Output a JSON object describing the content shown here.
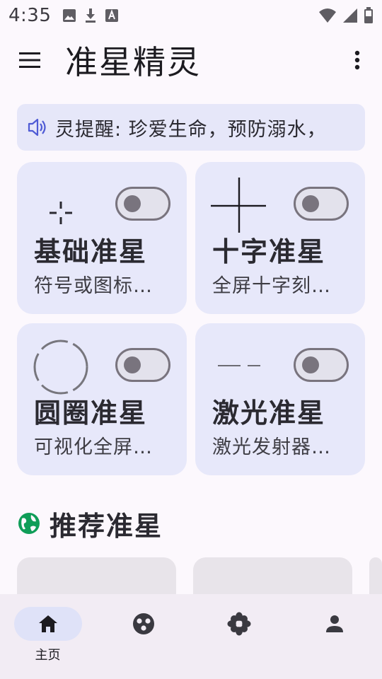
{
  "status_bar": {
    "time": "4:35",
    "left_icons": [
      "image-icon",
      "download-icon",
      "text-a-icon"
    ],
    "right_icons": [
      "wifi-icon",
      "signal-icon",
      "battery-icon"
    ]
  },
  "app_bar": {
    "title": "准星精灵",
    "menu_icon": "menu-icon",
    "more_icon": "more-vertical-icon"
  },
  "notice": {
    "icon": "speaker-icon",
    "text": "灵提醒: 珍爱生命，预防溺水，"
  },
  "cards": [
    {
      "title": "基础准星",
      "desc": "符号或图标…",
      "icon": "crosshair-basic-icon",
      "enabled": false
    },
    {
      "title": "十字准星",
      "desc": "全屏十字刻…",
      "icon": "crosshair-cross-icon",
      "enabled": false
    },
    {
      "title": "圆圈准星",
      "desc": "可视化全屏…",
      "icon": "crosshair-circle-icon",
      "enabled": false
    },
    {
      "title": "激光准星",
      "desc": "激光发射器…",
      "icon": "crosshair-laser-icon",
      "enabled": false
    }
  ],
  "recommend": {
    "icon": "globe-icon",
    "title": "推荐准星",
    "accent": "#0f9d58"
  },
  "bottom_nav": {
    "items": [
      {
        "label": "主页",
        "icon": "home-icon",
        "active": true
      },
      {
        "label": "",
        "icon": "palette-icon",
        "active": false
      },
      {
        "label": "",
        "icon": "flower-icon",
        "active": false
      },
      {
        "label": "",
        "icon": "person-icon",
        "active": false
      }
    ]
  },
  "colors": {
    "background": "#fcf8fd",
    "card": "#e7e8fa",
    "nav": "#f2ecf4",
    "active_pill": "#dfe2f8"
  }
}
